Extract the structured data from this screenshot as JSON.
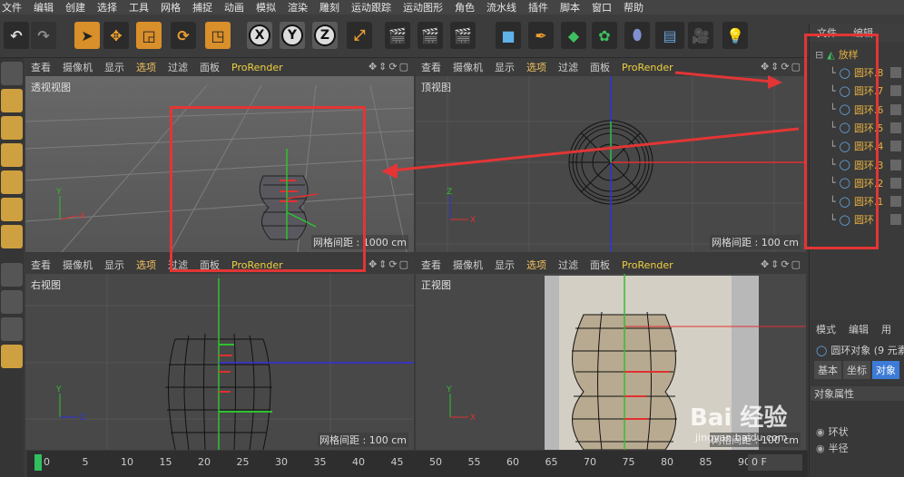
{
  "menu": [
    "文件",
    "编辑",
    "创建",
    "选择",
    "工具",
    "网格",
    "捕捉",
    "动画",
    "模拟",
    "渲染",
    "雕刻",
    "运动跟踪",
    "运动图形",
    "角色",
    "流水线",
    "插件",
    "脚本",
    "窗口",
    "帮助"
  ],
  "toolbar": {
    "axis_x": "X",
    "axis_y": "Y",
    "axis_z": "Z"
  },
  "viewports": {
    "menu": [
      "查看",
      "摄像机",
      "显示",
      "选项",
      "过滤",
      "面板",
      "ProRender"
    ],
    "perspective": {
      "title": "透视视图",
      "grid": "网格间距 : 1000 cm"
    },
    "top": {
      "title": "顶视图",
      "grid": "网格间距 : 100 cm"
    },
    "right": {
      "title": "右视图",
      "grid": "网格间距 : 100 cm"
    },
    "front": {
      "title": "正视图",
      "grid": "网格间距 : 100 cm"
    }
  },
  "object_manager": {
    "header": [
      "文件",
      "编辑"
    ],
    "root": "放样",
    "items": [
      "圆环.8",
      "圆环.7",
      "圆环.6",
      "圆环.5",
      "圆环.4",
      "圆环.3",
      "圆环.2",
      "圆环.1",
      "圆环"
    ]
  },
  "attributes": {
    "header": [
      "模式",
      "编辑",
      "用"
    ],
    "object_label": "圆环对象 (9 元素)",
    "tabs": [
      "基本",
      "坐标",
      "对象"
    ],
    "section": "对象属性",
    "ring_label": "环状",
    "radius_label": "半径"
  },
  "timeline": {
    "ticks": [
      "0",
      "5",
      "10",
      "15",
      "20",
      "25",
      "30",
      "35",
      "40",
      "45",
      "50",
      "55",
      "60",
      "65",
      "70",
      "75",
      "80",
      "85",
      "90"
    ],
    "frame": "0 F"
  },
  "watermark": {
    "brand": "Bai 经验",
    "url": "jingyan.baidu.com"
  }
}
